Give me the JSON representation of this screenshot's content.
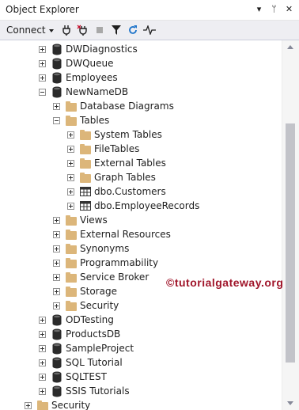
{
  "window": {
    "title": "Object Explorer"
  },
  "titlebar_buttons": [
    "▾",
    "ᛘ",
    "✕"
  ],
  "toolbar": {
    "connect_label": "Connect"
  },
  "tree": [
    {
      "label": "DWDiagnostics",
      "level": 2,
      "state": "plus",
      "icon": "database"
    },
    {
      "label": "DWQueue",
      "level": 2,
      "state": "plus",
      "icon": "database"
    },
    {
      "label": "Employees",
      "level": 2,
      "state": "plus",
      "icon": "database"
    },
    {
      "label": "NewNameDB",
      "level": 2,
      "state": "minus",
      "icon": "database"
    },
    {
      "label": "Database Diagrams",
      "level": 3,
      "state": "plus",
      "icon": "folder"
    },
    {
      "label": "Tables",
      "level": 3,
      "state": "minus",
      "icon": "folder"
    },
    {
      "label": "System Tables",
      "level": 4,
      "state": "plus",
      "icon": "folder"
    },
    {
      "label": "FileTables",
      "level": 4,
      "state": "plus",
      "icon": "folder"
    },
    {
      "label": "External Tables",
      "level": 4,
      "state": "plus",
      "icon": "folder"
    },
    {
      "label": "Graph Tables",
      "level": 4,
      "state": "plus",
      "icon": "folder"
    },
    {
      "label": "dbo.Customers",
      "level": 4,
      "state": "plus",
      "icon": "table"
    },
    {
      "label": "dbo.EmployeeRecords",
      "level": 4,
      "state": "plus",
      "icon": "table"
    },
    {
      "label": "Views",
      "level": 3,
      "state": "plus",
      "icon": "folder"
    },
    {
      "label": "External Resources",
      "level": 3,
      "state": "plus",
      "icon": "folder"
    },
    {
      "label": "Synonyms",
      "level": 3,
      "state": "plus",
      "icon": "folder"
    },
    {
      "label": "Programmability",
      "level": 3,
      "state": "plus",
      "icon": "folder"
    },
    {
      "label": "Service Broker",
      "level": 3,
      "state": "plus",
      "icon": "folder"
    },
    {
      "label": "Storage",
      "level": 3,
      "state": "plus",
      "icon": "folder"
    },
    {
      "label": "Security",
      "level": 3,
      "state": "plus",
      "icon": "folder"
    },
    {
      "label": "ODTesting",
      "level": 2,
      "state": "plus",
      "icon": "database"
    },
    {
      "label": "ProductsDB",
      "level": 2,
      "state": "plus",
      "icon": "database"
    },
    {
      "label": "SampleProject",
      "level": 2,
      "state": "plus",
      "icon": "database"
    },
    {
      "label": "SQL Tutorial",
      "level": 2,
      "state": "plus",
      "icon": "database"
    },
    {
      "label": "SQLTEST",
      "level": 2,
      "state": "plus",
      "icon": "database"
    },
    {
      "label": "SSIS Tutorials",
      "level": 2,
      "state": "plus",
      "icon": "database"
    },
    {
      "label": "Security",
      "level": 1,
      "state": "plus",
      "icon": "folder"
    }
  ],
  "watermark": "©tutorialgateway.org",
  "colors": {
    "folder": "#dcb67a",
    "watermark": "#a0152a",
    "toolbar_bg": "#eeeef2",
    "refresh": "#1c73c9"
  }
}
